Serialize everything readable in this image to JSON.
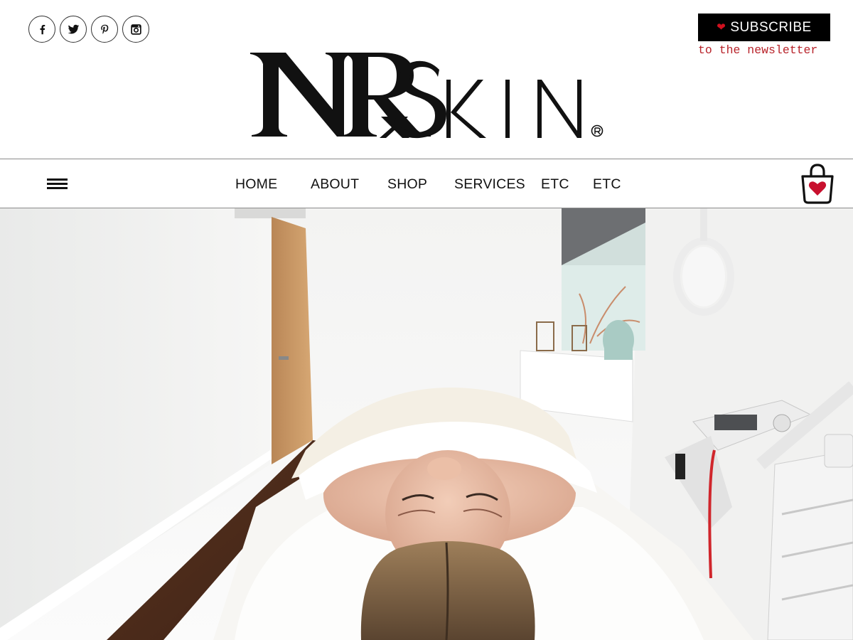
{
  "social": [
    {
      "network": "facebook",
      "icon": "facebook-icon",
      "glyph": "f"
    },
    {
      "network": "twitter",
      "icon": "twitter-icon"
    },
    {
      "network": "pinterest",
      "icon": "pinterest-icon",
      "glyph": "p"
    },
    {
      "network": "instagram",
      "icon": "instagram-icon"
    }
  ],
  "subscribe": {
    "label": "SUBSCRIBE",
    "sublabel": "to the newsletter",
    "heart_icon": "heart-icon",
    "heart_color": "#d0101e",
    "sublabel_color": "#b8232a"
  },
  "logo": {
    "monogram": "NRx",
    "wordmark": "SKIN",
    "registered": "®"
  },
  "nav": {
    "menu_icon": "hamburger-menu-icon",
    "items": [
      "HOME",
      "ABOUT",
      "SHOP",
      "SERVICES",
      "ETC",
      "ETC"
    ],
    "cart_icon": "shopping-bag-heart-icon",
    "cart_heart_color": "#c8102e"
  },
  "hero": {
    "alt": "Client relaxing on a treatment bed in a bright white skincare treatment room"
  }
}
